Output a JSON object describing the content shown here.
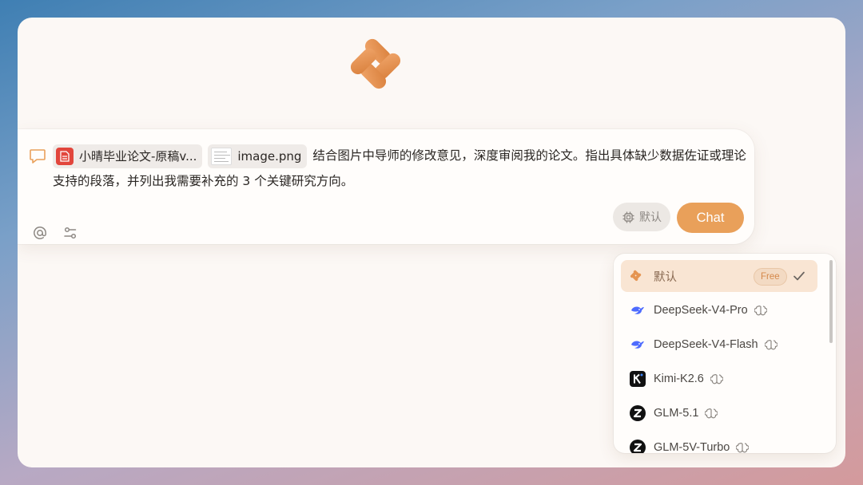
{
  "composer": {
    "attachments": [
      {
        "type": "document",
        "name": "小晴毕业论文-原稿v..."
      },
      {
        "type": "image",
        "name": "image.png"
      }
    ],
    "message": "结合图片中导师的修改意见，深度审阅我的论文。指出具体缺少数据佐证或理论支持的段落，并列出我需要补充的 3 个关键研究方向。",
    "model_selector_label": "默认",
    "send_label": "Chat"
  },
  "model_menu": {
    "items": [
      {
        "label": "默认",
        "badge": "Free",
        "selected": true,
        "icon": "app-logo-icon"
      },
      {
        "label": "DeepSeek-V4-Pro",
        "icon": "deepseek-icon",
        "reasoning": true
      },
      {
        "label": "DeepSeek-V4-Flash",
        "icon": "deepseek-icon",
        "reasoning": true
      },
      {
        "label": "Kimi-K2.6",
        "icon": "kimi-icon",
        "reasoning": true
      },
      {
        "label": "GLM-5.1",
        "icon": "zhipu-icon",
        "reasoning": true
      },
      {
        "label": "GLM-5V-Turbo",
        "icon": "zhipu-icon",
        "reasoning": true
      }
    ]
  },
  "colors": {
    "accent": "#e9a05a",
    "selected_bg": "#f9e5d3",
    "window_bg": "#fcf8f5"
  }
}
